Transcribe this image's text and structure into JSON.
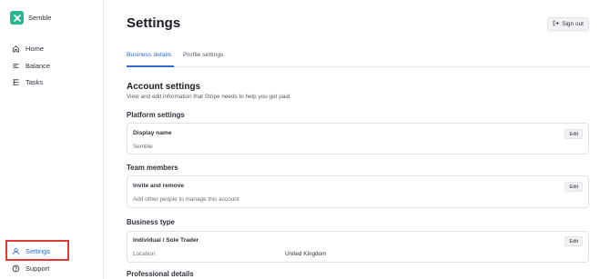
{
  "sidebar": {
    "brand": "Semble",
    "items": [
      {
        "label": "Home",
        "icon": "home-icon"
      },
      {
        "label": "Balance",
        "icon": "balance-icon"
      },
      {
        "label": "Tasks",
        "icon": "tasks-icon"
      },
      {
        "label": "Settings",
        "icon": "user-icon"
      },
      {
        "label": "Support",
        "icon": "help-icon"
      }
    ]
  },
  "header": {
    "title": "Settings",
    "signout_label": "Sign out"
  },
  "tabs": [
    {
      "label": "Business details",
      "active": true
    },
    {
      "label": "Profile settings",
      "active": false
    }
  ],
  "account": {
    "title": "Account settings",
    "subtitle": "View and edit information that Stripe needs to help you get paid"
  },
  "platform": {
    "heading": "Platform settings",
    "card_title": "Display name",
    "card_value": "Semble",
    "edit": "Edit"
  },
  "team": {
    "heading": "Team members",
    "card_title": "Invite and remove",
    "card_value": "Add other people to manage this account",
    "edit": "Edit"
  },
  "business": {
    "heading": "Business type",
    "card_title": "Individual / Sole Trader",
    "location_label": "Location",
    "location_value": "United Kingdom",
    "edit": "Edit"
  },
  "professional": {
    "heading": "Professional details"
  },
  "colors": {
    "accent": "#2e6bd7",
    "brand": "#29b78f",
    "highlight": "#e53935"
  }
}
